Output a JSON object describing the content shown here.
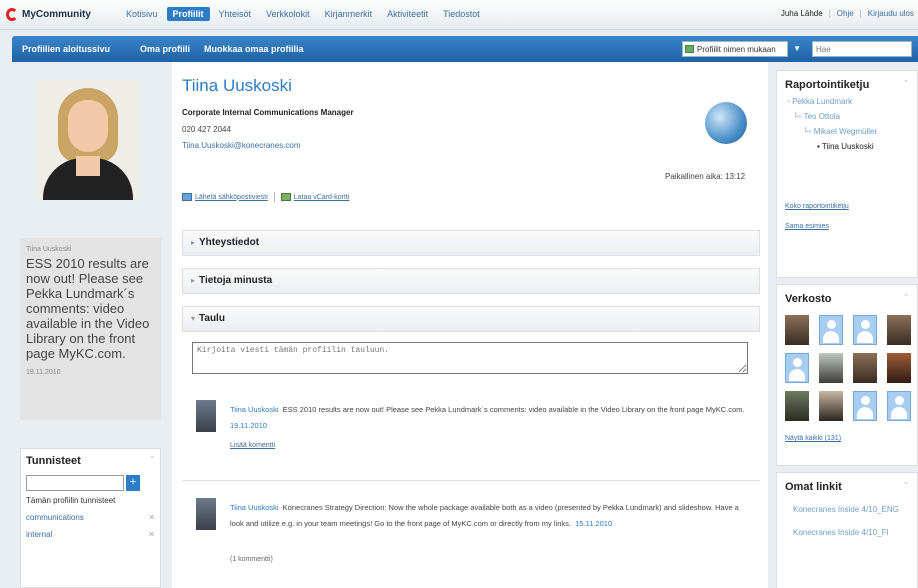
{
  "app": {
    "logo": "MyCommunity"
  },
  "topnav": [
    "Kotisivu",
    "Profiilit",
    "Yhteisöt",
    "Verkkolokit",
    "Kirjanmerkit",
    "Aktiviteetit",
    "Tiedostot"
  ],
  "topnav_active": 1,
  "user": {
    "name": "Juha Lähde",
    "help": "Ohje",
    "logout": "Kirjaudu ulos"
  },
  "subnav": [
    "Profiilien aloitussivu",
    "Oma profiili",
    "Muokkaa omaa profiilia"
  ],
  "sort_select": "Profiilit nimen mukaan",
  "search": {
    "placeholder": "Hae"
  },
  "status": {
    "name": "Tiina Uuskoski",
    "text": "ESS 2010 results are now out! Please see Pekka Lundmark´s comments: video available in the Video Library on the front page MyKC.com.",
    "date": "19.11.2010"
  },
  "tags": {
    "title": "Tunnisteet",
    "caption": "Tämän profiilin tunnisteet",
    "items": [
      "communications",
      "internal"
    ]
  },
  "profile": {
    "name": "Tiina Uuskoski",
    "title": "Corporate Internal Communications Manager",
    "phone": "020 427 2044",
    "email": "Tiina.Uuskoski@konecranes.com",
    "local_time": "Paikallinen aika: 13:12",
    "send_email": "Lähetä sähköpostiviesti",
    "vcard": "Lataa vCard-kortti"
  },
  "sections": {
    "contact": "Yhteystiedot",
    "about": "Tietoja minusta",
    "wall": "Taulu"
  },
  "wall": {
    "input_placeholder": "Kirjoita viesti tämän profiilin tauluun.",
    "posts": [
      {
        "author": "Tiina Uuskoski",
        "text": "ESS 2010 results are now out! Please see Pekka Lundmark´s comments: video available in the Video Library on the front page MyKC.com.",
        "date": "19.11.2010",
        "link": "Lisää komentti"
      },
      {
        "author": "Tiina Uuskoski",
        "text": "Konecranes Strategy Direction: Now the whole package available both as a video (presented by Pekka Lundmark) and slideshow. Have a look and utilize e.g. in your team meetings! Go to the front page of MyKC.com or directly from my links.",
        "date": "15.11.2010",
        "comments": "(1 kommentti)"
      }
    ]
  },
  "reporting": {
    "title": "Raportointiketju",
    "chain": [
      "Pekka Lundmark",
      "Teo Ottola",
      "Mikael Wegmüller",
      "Tiina Uuskoski"
    ],
    "full_link": "Koko raportointiketju",
    "same_boss": "Sama esimies"
  },
  "network": {
    "title": "Verkosto",
    "show_all": "Näytä kaikki (131)"
  },
  "links": {
    "title": "Omat linkit",
    "items": [
      "Konecranes Inside 4/10_ENG",
      "Konecranes Inside 4/10_FI"
    ]
  },
  "colors": {
    "accent": "#2c7cc6",
    "subnav": "#1f62a5",
    "logo_red": "#dd2222"
  }
}
